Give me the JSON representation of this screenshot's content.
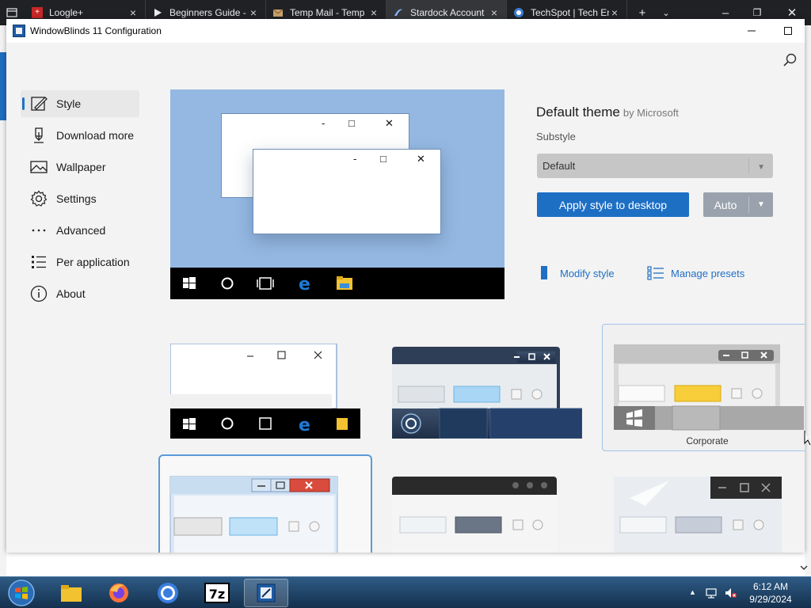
{
  "browser_tabs": [
    {
      "title": "Loogle+",
      "icon": "loogle-icon",
      "active": false
    },
    {
      "title": "Beginners Guide -",
      "icon": "play-icon",
      "active": false
    },
    {
      "title": "Temp Mail - Temp",
      "icon": "mail-icon",
      "active": false
    },
    {
      "title": "Stardock Account",
      "icon": "stardock-icon",
      "active": true
    },
    {
      "title": "TechSpot | Tech En",
      "icon": "techspot-icon",
      "active": false
    }
  ],
  "window": {
    "title": "WindowBlinds 11 Configuration"
  },
  "nav": [
    {
      "label": "Style",
      "icon": "style-icon",
      "selected": true
    },
    {
      "label": "Download more",
      "icon": "download-icon",
      "selected": false
    },
    {
      "label": "Wallpaper",
      "icon": "wallpaper-icon",
      "selected": false
    },
    {
      "label": "Settings",
      "icon": "gear-icon",
      "selected": false
    },
    {
      "label": "Advanced",
      "icon": "ellipsis-icon",
      "selected": false
    },
    {
      "label": "Per application",
      "icon": "list-icon",
      "selected": false
    },
    {
      "label": "About",
      "icon": "info-icon",
      "selected": false
    }
  ],
  "theme": {
    "name": "Default theme",
    "author": "by Microsoft",
    "substyle_label": "Substyle",
    "substyle_value": "Default",
    "apply_label": "Apply style to desktop",
    "auto_label": "Auto",
    "modify_label": "Modify style",
    "presets_label": "Manage presets"
  },
  "thumbnails": [
    {
      "name": "",
      "selected": false
    },
    {
      "name": "",
      "selected": false
    },
    {
      "name": "Corporate",
      "selected": false,
      "hovered": true
    },
    {
      "name": "",
      "selected": true
    },
    {
      "name": "",
      "selected": false
    },
    {
      "name": "",
      "selected": false
    }
  ],
  "clock": {
    "time": "6:12 AM",
    "date": "9/29/2024"
  },
  "colors": {
    "accent": "#1d6fc4",
    "preview_bg": "#94b8e2",
    "taskbar": "#14304e"
  }
}
